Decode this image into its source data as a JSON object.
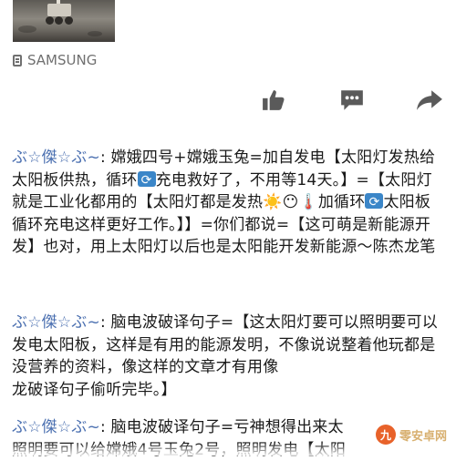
{
  "source": {
    "label": "SAMSUNG"
  },
  "actions": {
    "like": "like-icon",
    "comment": "comment-icon",
    "share": "share-icon"
  },
  "comments": [
    {
      "author": "ぶ☆傑☆ぶ~",
      "segments": [
        ": 嫦娥四号+嫦娥玉兔=加自发电【太阳灯发热给太阳板供热，循环",
        "充电救好了，不用等14天。】=【太阳灯就是工业化都用的【太阳灯都是发热",
        "加循环",
        "太阳板循环充电这样更好工作。】】=你们都说=【这可萌是新能源开发】也对，用上太阳灯以后也是太阳能开发新能源～陈杰龙笔"
      ],
      "emoji": "☀️😶🌡️"
    },
    {
      "author": "ぶ☆傑☆ぶ~",
      "text": ": 脑电波破译句子=【这太阳灯要可以照明要可以发电太阳板，这样是有用的能源发明，不像说说整着他玩都是没营养的资料，像这样的文章才有用像",
      "tail": "龙破译句子偷听完毕。】"
    },
    {
      "author": "ぶ☆傑☆ぶ~",
      "text": ": 脑电波破译句子=亏神想得出来太",
      "line2": "照明要可以给嫦娥4号玉兔2号，照明发电【太阳"
    }
  ],
  "watermark": {
    "logo": "九",
    "text": "零安卓网"
  },
  "colors": {
    "author": "#4a6fb0",
    "badge": "#3b86c8",
    "icon": "#5a5a5a"
  }
}
